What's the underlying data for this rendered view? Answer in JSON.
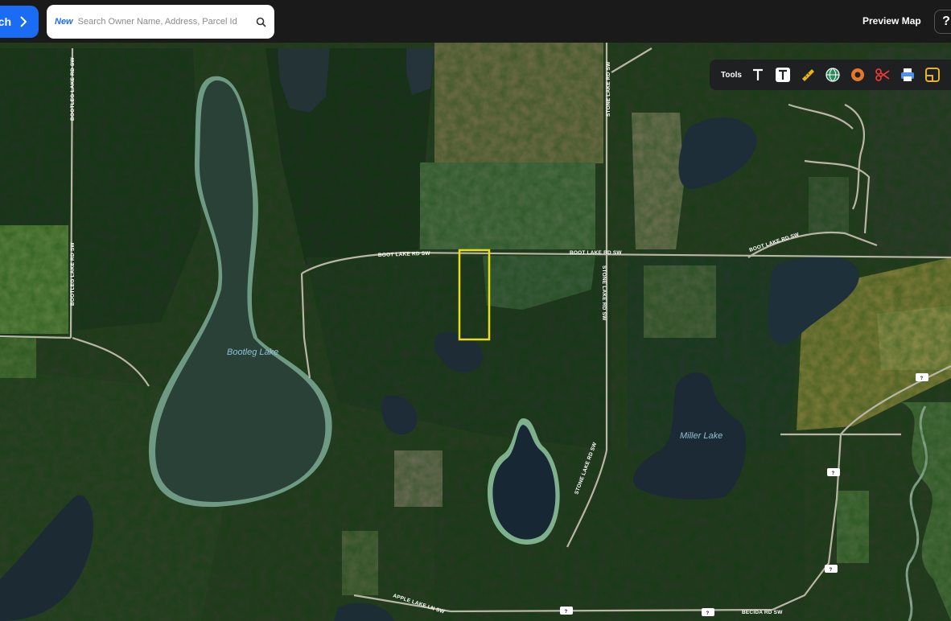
{
  "header": {
    "search_button_label": "ch",
    "search_new_badge": "New",
    "search_placeholder": "Search Owner Name, Address, Parcel Id",
    "preview_map_label": "Preview Map",
    "help_label": "?"
  },
  "toolbar": {
    "label": "Tools",
    "tools": [
      "text-tool",
      "text-box-tool",
      "measure-tool",
      "globe-tool",
      "buffer-tool",
      "cut-tool",
      "print-tool",
      "layers-tool"
    ]
  },
  "map": {
    "roads": {
      "bootleg_lake_rd_n": "BOOTLEG LAKE RD SW",
      "bootleg_lake_rd_s": "BOOTLEG LAKE RD SW",
      "stone_lake_rd_n": "STONE LAKE RD SW",
      "boot_lake_rd_w": "BOOT LAKE RD SW",
      "boot_lake_rd_c": "BOOT LAKE RD SW",
      "boot_lake_rd_e": "BOOT LAKE RD SW",
      "stone_lake_rd_mid": "STONE LAKE RD SW",
      "stone_lake_rd_s": "STONE LAKE RD SW",
      "apple_lake_ln": "APPLE LAKE LN SW",
      "becida_rd": "BECIDA RD SW"
    },
    "lakes": {
      "bootleg": "Bootleg Lake",
      "miller": "Miller Lake"
    },
    "shield_label": "?",
    "parcel_color": "#e8dd1f"
  }
}
